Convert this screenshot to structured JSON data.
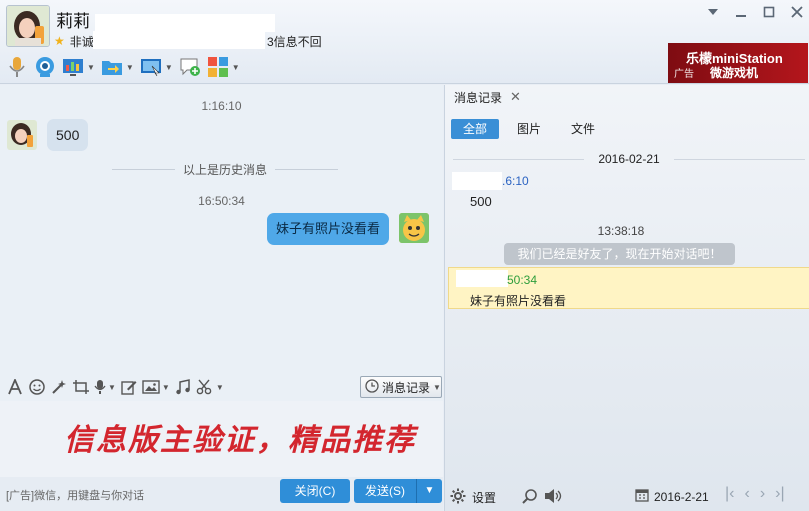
{
  "header": {
    "contact_name": "莉莉",
    "signature_prefix": "非诚",
    "signature_suffix": "3信息不回",
    "window_controls": [
      "chevron-down-icon",
      "minimize-icon",
      "maximize-icon",
      "close-icon"
    ]
  },
  "toolbar": {
    "items": [
      "microphone-icon",
      "video-call-icon",
      "remote-desktop-icon",
      "file-transfer-icon",
      "screen-share-icon",
      "add-chat-icon",
      "app-grid-icon"
    ]
  },
  "ad": {
    "brand": "乐檬miniStation",
    "tag": "广告",
    "title": "微游戏机"
  },
  "chat": {
    "time1": "1:16:10",
    "in_message": "500",
    "history_divider": "以上是历史消息",
    "time2": "16:50:34",
    "out_message": "妹子有照片没看看"
  },
  "input": {
    "tools": [
      "font-icon",
      "emoji-icon",
      "magic-icon",
      "screenshot-icon",
      "voice-icon",
      "edit-icon",
      "image-icon",
      "music-icon",
      "scissors-icon"
    ],
    "record_button": "消息记录",
    "watermark": "信息版主验证，精品推荐"
  },
  "bottom": {
    "ad_text": "[广告]微信，用键盘与你对话",
    "close_button": "关闭(C)",
    "send_button": "发送(S)"
  },
  "history_panel": {
    "tab_label": "消息记录",
    "filters": [
      "全部",
      "图片",
      "文件"
    ],
    "active_filter": "全部",
    "date": "2016-02-21",
    "rec1_time": ".6:10",
    "rec1_text": "500",
    "rec2_time": "13:38:18",
    "system_message": "我们已经是好友了，现在开始对话吧！",
    "rec3_time": "50:34",
    "rec3_text": "妹子有照片没看看",
    "settings_label": "设置",
    "footer_date": "2016-2-21"
  }
}
